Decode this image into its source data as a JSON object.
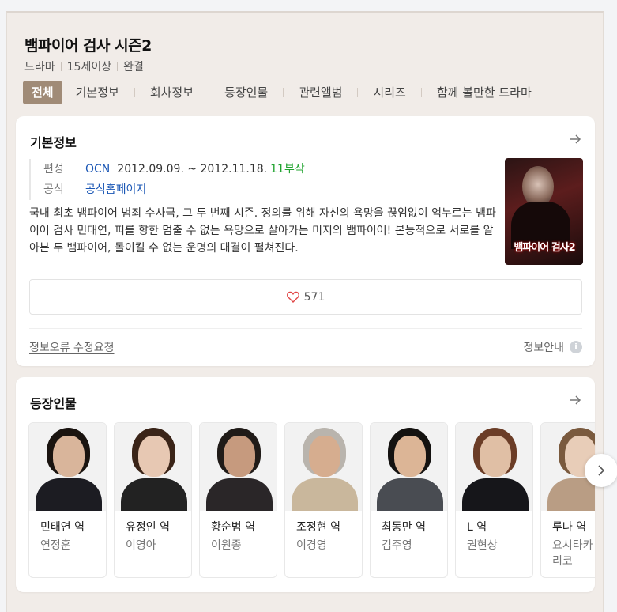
{
  "header": {
    "title": "뱀파이어 검사 시즌2",
    "meta": [
      "드라마",
      "15세이상",
      "완결"
    ]
  },
  "tabs": [
    {
      "label": "전체",
      "active": true
    },
    {
      "label": "기본정보"
    },
    {
      "label": "회차정보"
    },
    {
      "label": "등장인물"
    },
    {
      "label": "관련앨범"
    },
    {
      "label": "시리즈"
    },
    {
      "label": "함께 볼만한 드라마"
    }
  ],
  "basic_info": {
    "title": "기본정보",
    "broadcast_key": "편성",
    "channel": "OCN",
    "dates": "2012.09.09. ~ 2012.11.18.",
    "episodes": "11부작",
    "official_key": "공식",
    "official_link": "공식홈페이지",
    "description": "국내 최초 뱀파이어 범죄 수사극, 그 두 번째 시즌. 정의를 위해 자신의 욕망을 끊임없이 억누르는 뱀파이어 검사 민태연, 피를 향한 멈출 수 없는 욕망으로 살아가는 미지의 뱀파이어! 본능적으로 서로를 알아본 두 뱀파이어, 돌이킬 수 없는 운명의 대결이 펼쳐진다.",
    "poster_title": "뱀파이어 검사2",
    "like_count": "571",
    "report_link": "정보오류 수정요청",
    "info_guide": "정보안내",
    "info_icon_glyph": "i"
  },
  "cast_section": {
    "title": "등장인물",
    "people": [
      {
        "role": "민태연 역",
        "actor": "연정훈",
        "hair": "#1a1410",
        "skin": "#d9b59b",
        "cloth": "#1c1c22"
      },
      {
        "role": "유정인 역",
        "actor": "이영아",
        "hair": "#3a2418",
        "skin": "#e7c8b3",
        "cloth": "#222"
      },
      {
        "role": "황순범 역",
        "actor": "이원종",
        "hair": "#201b18",
        "skin": "#c69a7e",
        "cloth": "#2a2628"
      },
      {
        "role": "조정현 역",
        "actor": "이경영",
        "hair": "#b9b4ad",
        "skin": "#d6ad8f",
        "cloth": "#c9b79c"
      },
      {
        "role": "최동만 역",
        "actor": "김주영",
        "hair": "#141210",
        "skin": "#dcb596",
        "cloth": "#494c52"
      },
      {
        "role": "L 역",
        "actor": "권현상",
        "hair": "#6b3d27",
        "skin": "#e0bfa5",
        "cloth": "#16161a"
      },
      {
        "role": "루나 역",
        "actor": "요시타카 유리코",
        "hair": "#7a5a3e",
        "skin": "#e8cdb8",
        "cloth": "#b99d84"
      }
    ]
  },
  "colors": {
    "active_tab": "#a08b77",
    "link_blue": "#1b57b5",
    "episodes_green": "#20a32f",
    "heart": "#e04545"
  }
}
